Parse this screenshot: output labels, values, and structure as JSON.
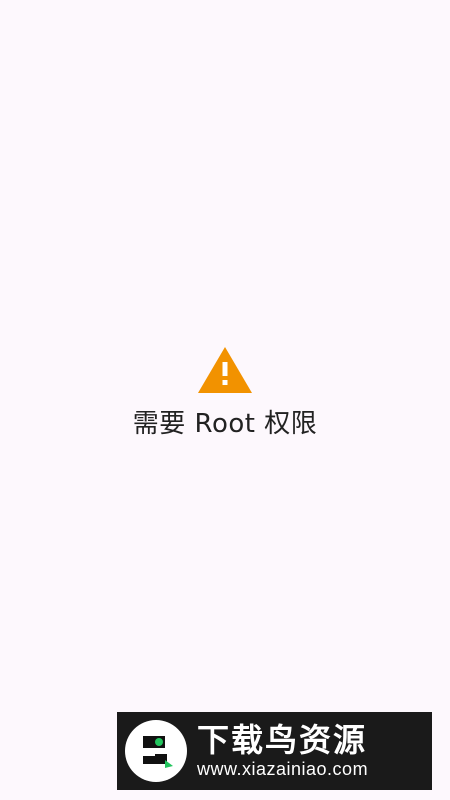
{
  "main": {
    "icon": "warning-icon",
    "message": "需要 Root 权限"
  },
  "watermark": {
    "logo_icon": "bird-logo-icon",
    "title": "下载鸟资源",
    "url": "www.xiazainiao.com"
  },
  "colors": {
    "background": "#fdf8fd",
    "warning": "#f29200",
    "text": "#222222",
    "watermark_bg": "#1a1a1a",
    "watermark_accent": "#22c55e"
  }
}
